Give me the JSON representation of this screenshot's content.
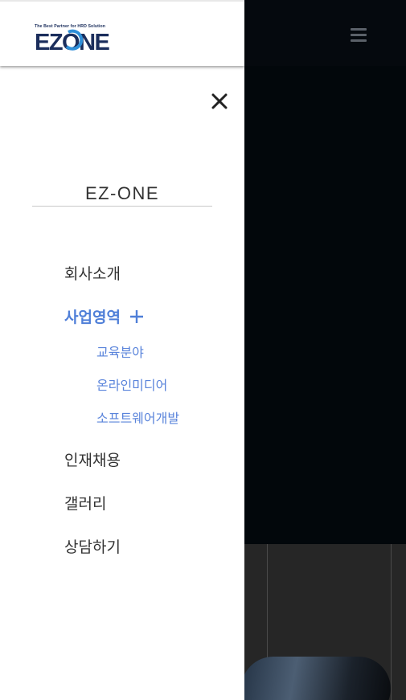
{
  "header": {
    "logo_tagline": "The Best Partner for HRD Solution",
    "logo_text": "EZONE"
  },
  "drawer": {
    "title": "EZ-ONE",
    "menu": [
      {
        "label": "회사소개"
      },
      {
        "label": "사업영역",
        "expanded": true,
        "children": [
          {
            "label": "교육분야"
          },
          {
            "label": "온라인미디어"
          },
          {
            "label": "소프트웨어개발"
          }
        ]
      },
      {
        "label": "인재채용"
      },
      {
        "label": "갤러리"
      },
      {
        "label": "상담하기"
      }
    ]
  },
  "colors": {
    "accent": "#4f7fd8",
    "logo_navy": "#1b2e5c",
    "logo_blue": "#2f8fd8"
  },
  "icons": {
    "close": "close-icon",
    "menu": "hamburger-menu-icon",
    "expand": "plus-icon"
  }
}
